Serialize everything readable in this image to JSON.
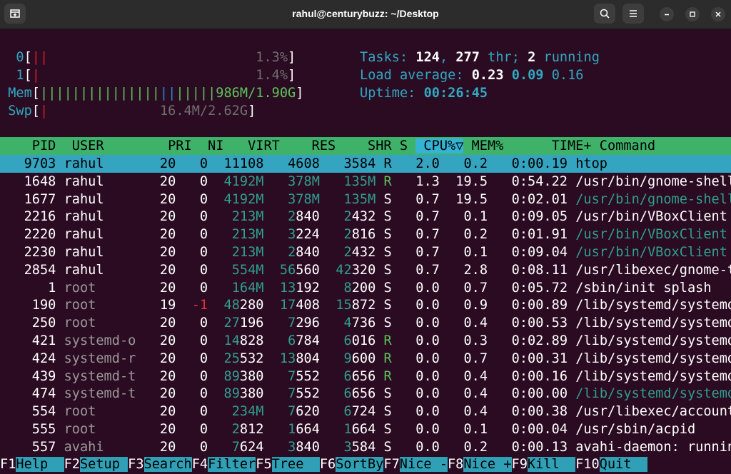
{
  "window": {
    "title": "rahul@centurybuzz: ~/Desktop"
  },
  "meters": {
    "cpu0": {
      "label": "0",
      "pct": "1.3%"
    },
    "cpu1": {
      "label": "1",
      "pct": "1.4%"
    },
    "mem": {
      "label": "Mem",
      "value": "986M/1.90G"
    },
    "swp": {
      "label": "Swp",
      "value": "16.4M/2.62G"
    }
  },
  "summary": {
    "tasks_label": "Tasks: ",
    "tasks": "124",
    "thr": "277",
    "thr_label": " thr; ",
    "running": "2",
    "running_label": " running",
    "load_label": "Load average: ",
    "load1": "0.23",
    "load5": "0.09",
    "load15": "0.16",
    "uptime_label": "Uptime: ",
    "uptime": "00:26:45"
  },
  "columns": [
    "PID",
    "USER",
    "PRI",
    "NI",
    "VIRT",
    "RES",
    "SHR",
    "S",
    "CPU%",
    "MEM%",
    "TIME+",
    "Command"
  ],
  "processes": [
    {
      "pid": "9703",
      "user": "rahul",
      "pri": "20",
      "ni": "0",
      "virt": "11108",
      "res": "4608",
      "shr": "3584",
      "s": "R",
      "cpu": "2.0",
      "mem": "0.2",
      "time": "0:00.19",
      "cmd": "htop"
    },
    {
      "pid": "1648",
      "user": "rahul",
      "pri": "20",
      "ni": "0",
      "virt": "4192M",
      "res": "378M",
      "shr": "135M",
      "s": "R",
      "cpu": "1.3",
      "mem": "19.5",
      "time": "0:54.22",
      "cmd": "/usr/bin/gnome-shell"
    },
    {
      "pid": "1677",
      "user": "rahul",
      "pri": "20",
      "ni": "0",
      "virt": "4192M",
      "res": "378M",
      "shr": "135M",
      "s": "S",
      "cpu": "0.7",
      "mem": "19.5",
      "time": "0:02.01",
      "cmd": "/usr/bin/gnome-shell"
    },
    {
      "pid": "2216",
      "user": "rahul",
      "pri": "20",
      "ni": "0",
      "virt": "213M",
      "res": "2840",
      "shr": "2432",
      "s": "S",
      "cpu": "0.7",
      "mem": "0.1",
      "time": "0:09.05",
      "cmd": "/usr/bin/VBoxClient --dr"
    },
    {
      "pid": "2220",
      "user": "rahul",
      "pri": "20",
      "ni": "0",
      "virt": "213M",
      "res": "3224",
      "shr": "2816",
      "s": "S",
      "cpu": "0.7",
      "mem": "0.2",
      "time": "0:01.91",
      "cmd": "/usr/bin/VBoxClient --se"
    },
    {
      "pid": "2230",
      "user": "rahul",
      "pri": "20",
      "ni": "0",
      "virt": "213M",
      "res": "2840",
      "shr": "2432",
      "s": "S",
      "cpu": "0.7",
      "mem": "0.1",
      "time": "0:09.04",
      "cmd": "/usr/bin/VBoxClient --dr"
    },
    {
      "pid": "2854",
      "user": "rahul",
      "pri": "20",
      "ni": "0",
      "virt": "554M",
      "res": "56560",
      "shr": "42320",
      "s": "S",
      "cpu": "0.7",
      "mem": "2.8",
      "time": "0:08.11",
      "cmd": "/usr/libexec/gnome-termi"
    },
    {
      "pid": "1",
      "user": "root",
      "pri": "20",
      "ni": "0",
      "virt": "164M",
      "res": "13192",
      "shr": "8200",
      "s": "S",
      "cpu": "0.0",
      "mem": "0.7",
      "time": "0:05.72",
      "cmd": "/sbin/init splash"
    },
    {
      "pid": "190",
      "user": "root",
      "pri": "19",
      "ni": "-1",
      "virt": "48280",
      "res": "17408",
      "shr": "15872",
      "s": "S",
      "cpu": "0.0",
      "mem": "0.9",
      "time": "0:00.89",
      "cmd": "/lib/systemd/systemd-jou"
    },
    {
      "pid": "250",
      "user": "root",
      "pri": "20",
      "ni": "0",
      "virt": "27196",
      "res": "7296",
      "shr": "4736",
      "s": "S",
      "cpu": "0.0",
      "mem": "0.4",
      "time": "0:00.53",
      "cmd": "/lib/systemd/systemd-ude"
    },
    {
      "pid": "421",
      "user": "systemd-o",
      "pri": "20",
      "ni": "0",
      "virt": "14828",
      "res": "6784",
      "shr": "6016",
      "s": "R",
      "cpu": "0.0",
      "mem": "0.3",
      "time": "0:02.89",
      "cmd": "/lib/systemd/systemd-oom"
    },
    {
      "pid": "424",
      "user": "systemd-r",
      "pri": "20",
      "ni": "0",
      "virt": "25532",
      "res": "13804",
      "shr": "9600",
      "s": "R",
      "cpu": "0.0",
      "mem": "0.7",
      "time": "0:00.31",
      "cmd": "/lib/systemd/systemd-res"
    },
    {
      "pid": "439",
      "user": "systemd-t",
      "pri": "20",
      "ni": "0",
      "virt": "89380",
      "res": "7552",
      "shr": "6656",
      "s": "R",
      "cpu": "0.0",
      "mem": "0.4",
      "time": "0:00.16",
      "cmd": "/lib/systemd/systemd-tim"
    },
    {
      "pid": "474",
      "user": "systemd-t",
      "pri": "20",
      "ni": "0",
      "virt": "89380",
      "res": "7552",
      "shr": "6656",
      "s": "S",
      "cpu": "0.0",
      "mem": "0.4",
      "time": "0:00.00",
      "cmd": "/lib/systemd/systemd-tim"
    },
    {
      "pid": "554",
      "user": "root",
      "pri": "20",
      "ni": "0",
      "virt": "234M",
      "res": "7620",
      "shr": "6724",
      "s": "S",
      "cpu": "0.0",
      "mem": "0.4",
      "time": "0:00.38",
      "cmd": "/usr/libexec/accounts-da"
    },
    {
      "pid": "555",
      "user": "root",
      "pri": "20",
      "ni": "0",
      "virt": "2812",
      "res": "1664",
      "shr": "1664",
      "s": "S",
      "cpu": "0.0",
      "mem": "0.1",
      "time": "0:00.04",
      "cmd": "/usr/sbin/acpid"
    },
    {
      "pid": "557",
      "user": "avahi",
      "pri": "20",
      "ni": "0",
      "virt": "7624",
      "res": "3840",
      "shr": "3584",
      "s": "S",
      "cpu": "0.0",
      "mem": "0.2",
      "time": "0:00.13",
      "cmd": "avahi-daemon: running [c"
    }
  ],
  "fkeys": [
    {
      "key": "F1",
      "label": "Help  "
    },
    {
      "key": "F2",
      "label": "Setup "
    },
    {
      "key": "F3",
      "label": "Search"
    },
    {
      "key": "F4",
      "label": "Filter"
    },
    {
      "key": "F5",
      "label": "Tree  "
    },
    {
      "key": "F6",
      "label": "SortBy"
    },
    {
      "key": "F7",
      "label": "Nice -"
    },
    {
      "key": "F8",
      "label": "Nice +"
    },
    {
      "key": "F9",
      "label": "Kill  "
    },
    {
      "key": "F10",
      "label": "Quit  "
    }
  ]
}
